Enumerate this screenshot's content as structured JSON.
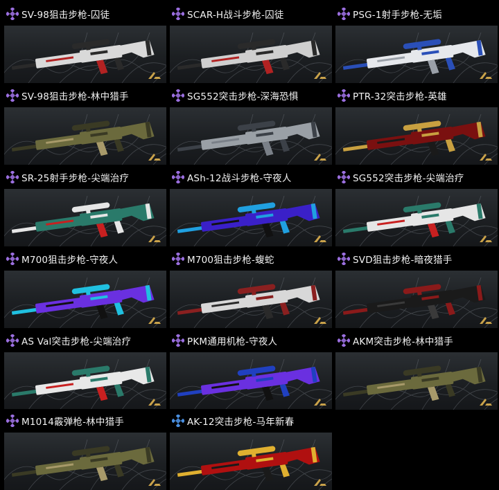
{
  "items": [
    {
      "name": "SV-98狙击步枪-囚徒",
      "rarity": "purple",
      "skin": "white-camo",
      "colors": [
        "#d9d9d9",
        "#2a2a2a",
        "#b22222"
      ]
    },
    {
      "name": "SCAR-H战斗步枪-囚徒",
      "rarity": "purple",
      "skin": "white-camo",
      "colors": [
        "#cfcfcf",
        "#2a2a2a",
        "#b22222"
      ]
    },
    {
      "name": "PSG-1射手步枪-无垢",
      "rarity": "purple",
      "skin": "white-blue",
      "colors": [
        "#e6e8ec",
        "#2a4fb8",
        "#9aa0a8"
      ]
    },
    {
      "name": "SV-98狙击步枪-林中猎手",
      "rarity": "purple",
      "skin": "forest-camo",
      "colors": [
        "#6b6a3d",
        "#3a3a24",
        "#a89a6a"
      ]
    },
    {
      "name": "SG552突击步枪-深海恐惧",
      "rarity": "purple",
      "skin": "deep-sea",
      "colors": [
        "#9aa0a6",
        "#3c4148",
        "#7a8088"
      ]
    },
    {
      "name": "PTR-32突击步枪-英雄",
      "rarity": "purple",
      "skin": "red-gold",
      "colors": [
        "#7a1010",
        "#c8a040",
        "#1a1a1a"
      ]
    },
    {
      "name": "SR-25射手步枪-尖端治疗",
      "rarity": "purple",
      "skin": "medic",
      "colors": [
        "#2a7a6a",
        "#e6e6e6",
        "#c82020"
      ]
    },
    {
      "name": "ASh-12战斗步枪-守夜人",
      "rarity": "purple",
      "skin": "night-watch",
      "colors": [
        "#3a20c8",
        "#20a0e0",
        "#111111"
      ]
    },
    {
      "name": "SG552突击步枪-尖端治疗",
      "rarity": "purple",
      "skin": "medic",
      "colors": [
        "#e6e6e6",
        "#2a7a6a",
        "#c82020"
      ]
    },
    {
      "name": "M700狙击步枪-守夜人",
      "rarity": "purple",
      "skin": "night-watch",
      "colors": [
        "#6a30e0",
        "#20c0e0",
        "#111111"
      ]
    },
    {
      "name": "M700狙击步枪-蝮蛇",
      "rarity": "purple",
      "skin": "viper",
      "colors": [
        "#d8d8d8",
        "#8a2020",
        "#2a2a2a"
      ]
    },
    {
      "name": "SVD狙击步枪-暗夜猎手",
      "rarity": "purple",
      "skin": "dark-hunter",
      "colors": [
        "#1a1a1a",
        "#8a1a1a",
        "#3a3a3a"
      ]
    },
    {
      "name": "AS Val突击步枪-尖端治疗",
      "rarity": "purple",
      "skin": "medic",
      "colors": [
        "#e8e8e8",
        "#2a7a6a",
        "#c82020"
      ]
    },
    {
      "name": "PKM通用机枪-守夜人",
      "rarity": "purple",
      "skin": "night-watch",
      "colors": [
        "#6a30e0",
        "#2040c0",
        "#111111"
      ]
    },
    {
      "name": "AKM突击步枪-林中猎手",
      "rarity": "purple",
      "skin": "forest-camo",
      "colors": [
        "#6b6a3d",
        "#3a3a24",
        "#a89a6a"
      ]
    },
    {
      "name": "M1014霰弹枪-林中猎手",
      "rarity": "purple",
      "skin": "forest-camo",
      "colors": [
        "#6b6a3d",
        "#3a3a24",
        "#a89a6a"
      ]
    },
    {
      "name": "AK-12突击步枪-马年新春",
      "rarity": "blue",
      "skin": "lunar-new-year",
      "colors": [
        "#b01010",
        "#e0b030",
        "#1a1a1a"
      ]
    }
  ],
  "rarity_colors": {
    "purple": "#9b6fe0",
    "blue": "#4a90e2"
  }
}
